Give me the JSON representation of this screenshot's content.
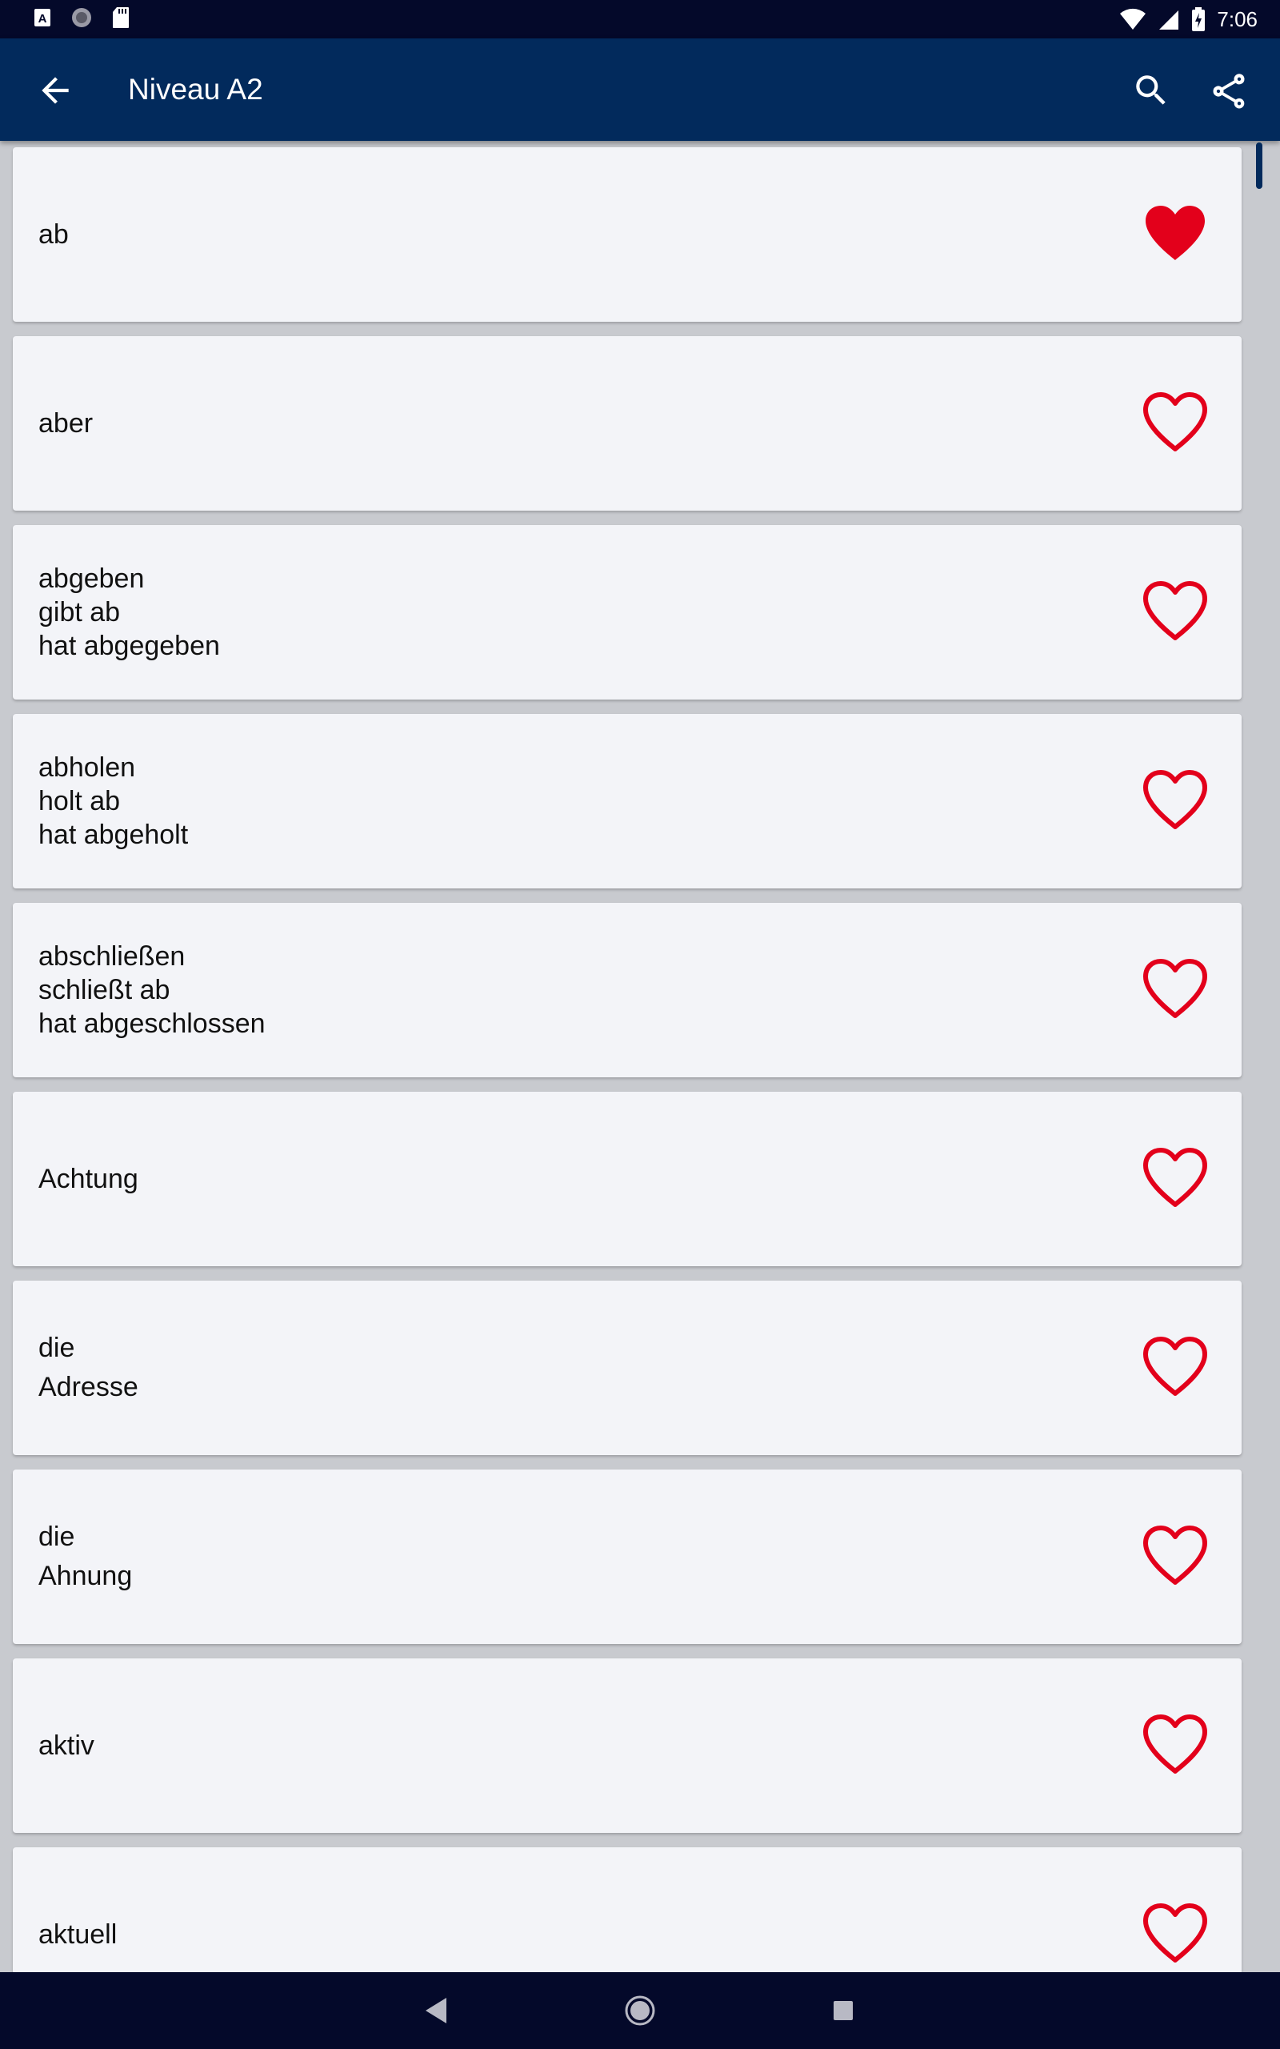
{
  "status_bar": {
    "time": "7:06",
    "left_icons": [
      "a-box-icon",
      "circle-icon",
      "sd-card-icon"
    ],
    "right_icons": [
      "wifi-icon",
      "signal-icon",
      "battery-icon"
    ]
  },
  "app_bar": {
    "title": "Niveau A2",
    "actions": [
      "search-icon",
      "share-icon"
    ]
  },
  "colors": {
    "app_bar_bg": "#022a5c",
    "status_bar_bg": "#04092a",
    "card_bg": "#f3f4f8",
    "heart_red": "#e3001b"
  },
  "words": [
    {
      "lines": [
        "ab"
      ],
      "favorite": true
    },
    {
      "lines": [
        "aber"
      ],
      "favorite": false
    },
    {
      "lines": [
        "abgeben",
        "gibt ab",
        "hat abgegeben"
      ],
      "favorite": false
    },
    {
      "lines": [
        "abholen",
        "holt ab",
        "hat abgeholt"
      ],
      "favorite": false
    },
    {
      "lines": [
        "abschließen",
        "schließt ab",
        "hat abgeschlossen"
      ],
      "favorite": false
    },
    {
      "lines": [
        "Achtung"
      ],
      "favorite": false
    },
    {
      "lines": [
        "die",
        "Adresse"
      ],
      "favorite": false
    },
    {
      "lines": [
        "die",
        "Ahnung"
      ],
      "favorite": false
    },
    {
      "lines": [
        "aktiv"
      ],
      "favorite": false
    },
    {
      "lines": [
        "aktuell"
      ],
      "favorite": false
    }
  ],
  "nav_bar": [
    "back-triangle-icon",
    "home-circle-icon",
    "recents-square-icon"
  ]
}
